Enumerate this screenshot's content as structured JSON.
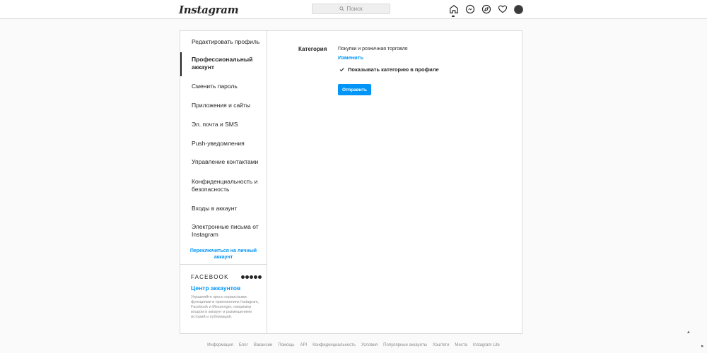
{
  "header": {
    "logo": "Instagram",
    "search_placeholder": "Поиск",
    "nav_icons": [
      "home-icon",
      "messenger-icon",
      "explore-icon",
      "heart-icon",
      "avatar"
    ]
  },
  "sidebar": {
    "items": [
      {
        "label": "Редактировать профиль"
      },
      {
        "label": "Профессиональный аккаунт"
      },
      {
        "label": "Сменить пароль"
      },
      {
        "label": "Приложения и сайты"
      },
      {
        "label": "Эл. почта и SMS"
      },
      {
        "label": "Push-уведомления"
      },
      {
        "label": "Управление контактами"
      },
      {
        "label": "Конфиденциальность и безопасность"
      },
      {
        "label": "Входы в аккаунт"
      },
      {
        "label": "Электронные письма от Instagram"
      }
    ],
    "switch_link": "Переключиться на личный аккаунт",
    "facebook": {
      "wordmark": "FACEBOOK",
      "title": "Центр аккаунтов",
      "description": "Управляйте кросс-сервисными функциями в приложениях Instagram, Facebook и Messenger, например входом в аккаунт и размещением историй и публикаций."
    }
  },
  "content": {
    "category_label": "Категория",
    "category_value": "Покупки и розничная торговля",
    "change_link": "Изменить",
    "show_category_label": "Показывать категорию в профиле",
    "show_category_checked": true,
    "submit_label": "Отправить"
  },
  "footer": {
    "links": [
      "Информация",
      "Блог",
      "Вакансии",
      "Помощь",
      "API",
      "Конфиденциальность",
      "Условия",
      "Популярные аккаунты",
      "Хэштеги",
      "Места",
      "Instagram Lite"
    ]
  },
  "colors": {
    "accent": "#0095f6",
    "text": "#262626",
    "muted": "#8e8e8e",
    "border": "#dbdbdb",
    "background": "#fafafa"
  }
}
